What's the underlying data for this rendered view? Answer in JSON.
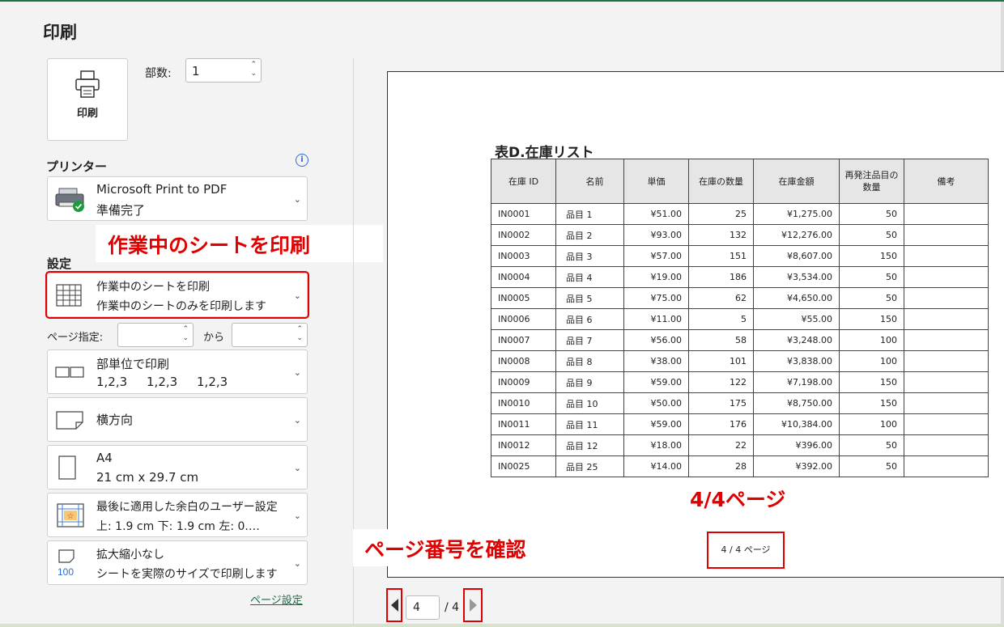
{
  "title": "印刷",
  "print_button": {
    "label": "印刷"
  },
  "copies": {
    "label": "部数:",
    "value": "1"
  },
  "printer": {
    "heading": "プリンター",
    "name": "Microsoft Print to PDF",
    "status": "準備完了"
  },
  "settings": {
    "heading": "設定",
    "scope": {
      "title": "作業中のシートを印刷",
      "sub": "作業中のシートのみを印刷します"
    },
    "page_range": {
      "label": "ページ指定:",
      "to": "から",
      "from_value": "",
      "to_value": ""
    },
    "collate": {
      "title": "部単位で印刷",
      "sub": "1,2,3     1,2,3     1,2,3"
    },
    "orientation": {
      "title": "横方向"
    },
    "paper": {
      "title": "A4",
      "sub": "21 cm x 29.7 cm"
    },
    "margins": {
      "title": "最後に適用した余白のユーザー設定",
      "sub": "上: 1.9 cm 下: 1.9 cm 左: 0.…"
    },
    "scaling": {
      "title": "拡大縮小なし",
      "sub": "シートを実際のサイズで印刷します",
      "icon_text": "100"
    },
    "page_setup_link": "ページ設定"
  },
  "annotations": {
    "print_active_sheet": "作業中のシートを印刷",
    "check_page_number": "ページ番号を確認",
    "page_indicator": "4/4ページ"
  },
  "preview": {
    "table_title": "表D.在庫リスト",
    "headers": [
      "在庫 ID",
      "名前",
      "単価",
      "在庫の数量",
      "在庫金額",
      "再発注品目の\n数量",
      "備考"
    ],
    "rows": [
      [
        "IN0001",
        "品目 1",
        "¥51.00",
        "25",
        "¥1,275.00",
        "50",
        ""
      ],
      [
        "IN0002",
        "品目 2",
        "¥93.00",
        "132",
        "¥12,276.00",
        "50",
        ""
      ],
      [
        "IN0003",
        "品目 3",
        "¥57.00",
        "151",
        "¥8,607.00",
        "150",
        ""
      ],
      [
        "IN0004",
        "品目 4",
        "¥19.00",
        "186",
        "¥3,534.00",
        "50",
        ""
      ],
      [
        "IN0005",
        "品目 5",
        "¥75.00",
        "62",
        "¥4,650.00",
        "50",
        ""
      ],
      [
        "IN0006",
        "品目 6",
        "¥11.00",
        "5",
        "¥55.00",
        "150",
        ""
      ],
      [
        "IN0007",
        "品目 7",
        "¥56.00",
        "58",
        "¥3,248.00",
        "100",
        ""
      ],
      [
        "IN0008",
        "品目 8",
        "¥38.00",
        "101",
        "¥3,838.00",
        "100",
        ""
      ],
      [
        "IN0009",
        "品目 9",
        "¥59.00",
        "122",
        "¥7,198.00",
        "150",
        ""
      ],
      [
        "IN0010",
        "品目 10",
        "¥50.00",
        "175",
        "¥8,750.00",
        "150",
        ""
      ],
      [
        "IN0011",
        "品目 11",
        "¥59.00",
        "176",
        "¥10,384.00",
        "100",
        ""
      ],
      [
        "IN0012",
        "品目 12",
        "¥18.00",
        "22",
        "¥396.00",
        "50",
        ""
      ],
      [
        "IN0025",
        "品目 25",
        "¥14.00",
        "28",
        "¥392.00",
        "50",
        ""
      ]
    ],
    "footer": "4 / 4 ページ"
  },
  "pager": {
    "current": "4",
    "total": "/ 4"
  },
  "colors": {
    "accent_green": "#217346",
    "highlight_red": "#e00000"
  }
}
